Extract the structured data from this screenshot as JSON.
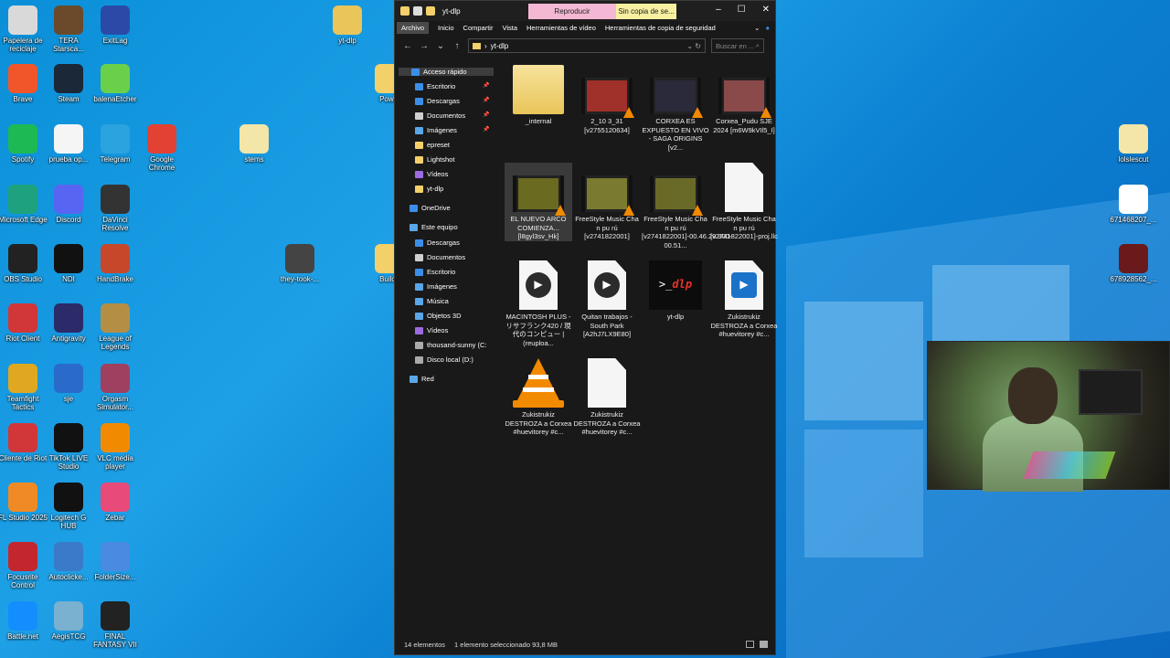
{
  "desktop": {
    "icons": [
      {
        "label": "Papelera de reciclaje",
        "icon": "recycle-bin-icon",
        "color": "#d9d9d9"
      },
      {
        "label": "TERA Starsca...",
        "icon": "tera-icon",
        "color": "#6a4a2a"
      },
      {
        "label": "ExitLag",
        "icon": "exitlag-icon",
        "color": "#2b4aa8"
      },
      {
        "label": "yt-dlp",
        "icon": "archive-icon",
        "color": "#e9c55a"
      },
      {
        "label": "Brave",
        "icon": "brave-icon",
        "color": "#f1562b"
      },
      {
        "label": "Steam",
        "icon": "steam-icon",
        "color": "#1b2838"
      },
      {
        "label": "balenaEtcher",
        "icon": "etcher-icon",
        "color": "#6ad04a"
      },
      {
        "label": "Pow...",
        "icon": "folder-icon",
        "color": "#f3d06a"
      },
      {
        "label": "Spotify",
        "icon": "spotify-icon",
        "color": "#1db954"
      },
      {
        "label": "prueba op...",
        "icon": "document-icon",
        "color": "#f5f5f5"
      },
      {
        "label": "Telegram",
        "icon": "telegram-icon",
        "color": "#2aa3df"
      },
      {
        "label": "Google Chrome",
        "icon": "chrome-icon",
        "color": "#e34133"
      },
      {
        "label": "stems",
        "icon": "archive-icon",
        "color": "#f3e6a8"
      },
      {
        "label": "lolslescut",
        "icon": "folder-icon",
        "color": "#f3e6a8"
      },
      {
        "label": "Microsoft Edge",
        "icon": "edge-icon",
        "color": "#1da27d"
      },
      {
        "label": "Discord",
        "icon": "discord-icon",
        "color": "#5865f2"
      },
      {
        "label": "DaVinci Resolve",
        "icon": "davinci-icon",
        "color": "#333333"
      },
      {
        "label": "671468207_...",
        "icon": "image-icon",
        "color": "#ffffff"
      },
      {
        "label": "OBS Studio",
        "icon": "obs-icon",
        "color": "#222222"
      },
      {
        "label": "NDI",
        "icon": "ndi-icon",
        "color": "#111111"
      },
      {
        "label": "HandBrake",
        "icon": "handbrake-icon",
        "color": "#c7472b"
      },
      {
        "label": "they-took-...",
        "icon": "video-icon",
        "color": "#444444"
      },
      {
        "label": "Builds",
        "icon": "folder-icon",
        "color": "#f3d06a"
      },
      {
        "label": "678928562_...",
        "icon": "image-icon",
        "color": "#6a1a1a"
      },
      {
        "label": "Riot Client",
        "icon": "riot-icon",
        "color": "#d13639"
      },
      {
        "label": "Antigravity",
        "icon": "antigravity-icon",
        "color": "#2b2b6a"
      },
      {
        "label": "League of Legends",
        "icon": "lol-icon",
        "color": "#b58e45"
      },
      {
        "label": "Teamfight Tactics",
        "icon": "tft-icon",
        "color": "#e0a820"
      },
      {
        "label": "sje",
        "icon": "media-file-icon",
        "color": "#2a6ac8"
      },
      {
        "label": "Orgasm Simulator...",
        "icon": "game-icon",
        "color": "#a04060"
      },
      {
        "label": "Cliente de Riot",
        "icon": "riot-icon",
        "color": "#d13639"
      },
      {
        "label": "TikTok LIVE Studio",
        "icon": "tiktok-icon",
        "color": "#111111"
      },
      {
        "label": "VLC media player",
        "icon": "vlc-icon",
        "color": "#f28a00"
      },
      {
        "label": "FL Studio 2025",
        "icon": "flstudio-icon",
        "color": "#f08a24"
      },
      {
        "label": "Logitech G HUB",
        "icon": "logitech-icon",
        "color": "#111111"
      },
      {
        "label": "Zebar",
        "icon": "zebar-icon",
        "color": "#e84a7a"
      },
      {
        "label": "Focusrite Control",
        "icon": "focusrite-icon",
        "color": "#c4262e"
      },
      {
        "label": "Autoclicke...",
        "icon": "autoclicker-icon",
        "color": "#3a7ac8"
      },
      {
        "label": "FolderSize...",
        "icon": "foldersize-icon",
        "color": "#4a8ae0"
      },
      {
        "label": "Battle.net",
        "icon": "battlenet-icon",
        "color": "#148eff"
      },
      {
        "label": "AegisTCG",
        "icon": "aegis-icon",
        "color": "#7ab0d0"
      },
      {
        "label": "FINAL FANTASY VII",
        "icon": "ff7-icon",
        "color": "#222222"
      }
    ]
  },
  "window": {
    "title": "yt-dlp",
    "ctx_play": "Reproducir",
    "ctx_nocopy": "Sin copia de se...",
    "controls": [
      "–",
      "☐",
      "✕"
    ],
    "ribbon_tabs": [
      "Archivo",
      "Inicio",
      "Compartir",
      "Vista",
      "Herramientas de vídeo",
      "Herramientas de copia de seguridad"
    ],
    "address": "yt-dlp",
    "search_placeholder": "Buscar en ...",
    "nav": {
      "quick_access": "Acceso rápido",
      "quick_items": [
        "Escritorio",
        "Descargas",
        "Documentos",
        "Imágenes",
        "epreset",
        "Lightshot",
        "Vídeos",
        "yt-dlp"
      ],
      "onedrive": "OneDrive",
      "this_pc": "Este equipo",
      "pc_items": [
        "Descargas",
        "Documentos",
        "Escritorio",
        "Imágenes",
        "Música",
        "Objetos 3D",
        "Vídeos",
        "thousand-sunny (C:",
        "Disco local (D:)"
      ],
      "network": "Red"
    },
    "files": [
      {
        "name": "_internal",
        "kind": "folder"
      },
      {
        "name": "2_10 3_31 [v2755120634]",
        "kind": "video",
        "tint": "#a0302a"
      },
      {
        "name": "CORXEA ES EXPUESTO EN VIVO - SAGA ORIGINS [v2...",
        "kind": "video",
        "tint": "#2a2a3a"
      },
      {
        "name": "Corxea_Pudu SJE 2024 [m6W9kVIl5_I]",
        "kind": "video",
        "tint": "#8a4a4a"
      },
      {
        "name": "EL NUEVO ARCO COMIENZA... [l8gyl3sv_Hk]",
        "kind": "video",
        "tint": "#6a6a20"
      },
      {
        "name": "FreeStyle Music Cha n pu rú [v2741822001]",
        "kind": "video",
        "tint": "#7a7a30"
      },
      {
        "name": "FreeStyle Music Cha n pu rú [v2741822001]-00.46.29.900-00.51...",
        "kind": "video",
        "tint": "#6a6a28"
      },
      {
        "name": "FreeStyle Music Cha n pu rú [v2741822001]-proj.llc",
        "kind": "doc"
      },
      {
        "name": "MACINTOSH PLUS - リサフランク420 / 現代のコンピュー | (reuploa...",
        "kind": "media"
      },
      {
        "name": "Quitan trabajos - South Park [A2hJ7LX9E80]",
        "kind": "media"
      },
      {
        "name": "yt-dlp",
        "kind": "term",
        "prompt": ">_",
        "brand": "dlp"
      },
      {
        "name": "Zukistrukiz DESTROZA a Corxea #huevitorey #c...",
        "kind": "media-blue"
      },
      {
        "name": "Zukistrukiz DESTROZA a Corxea #huevitorey #c...",
        "kind": "vlc"
      },
      {
        "name": "Zukistrukiz DESTROZA a Corxea #huevitorey #c...",
        "kind": "doc"
      }
    ],
    "status": {
      "count": "14 elementos",
      "selection": "1 elemento seleccionado 93,8 MB"
    }
  }
}
